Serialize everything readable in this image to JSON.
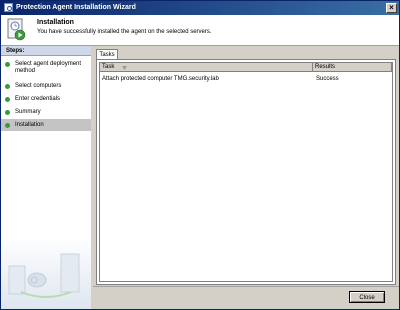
{
  "window": {
    "title": "Protection Agent Installation Wizard",
    "close_glyph": "×"
  },
  "header": {
    "title": "Installation",
    "subtitle": "You have successfully installed the agent on the selected servers."
  },
  "steps": {
    "heading": "Steps:",
    "items": [
      {
        "label": "Select agent deployment method",
        "status": "completed"
      },
      {
        "label": "Select computers",
        "status": "completed"
      },
      {
        "label": "Enter credentials",
        "status": "completed"
      },
      {
        "label": "Summary",
        "status": "completed"
      },
      {
        "label": "Installation",
        "status": "current"
      }
    ]
  },
  "tabs": [
    {
      "label": "Tasks",
      "selected": true
    }
  ],
  "table": {
    "columns": [
      {
        "label": "Task"
      },
      {
        "label": "Results"
      }
    ],
    "rows": [
      {
        "task": "Attach protected computer TMG.security.lab",
        "result": "Success"
      }
    ]
  },
  "buttons": {
    "close": "Close"
  },
  "colors": {
    "titlebar_start": "#0a246a",
    "titlebar_end": "#3a6ea5",
    "step_completed": "#3a9a3a",
    "chrome": "#d4d0c8"
  }
}
